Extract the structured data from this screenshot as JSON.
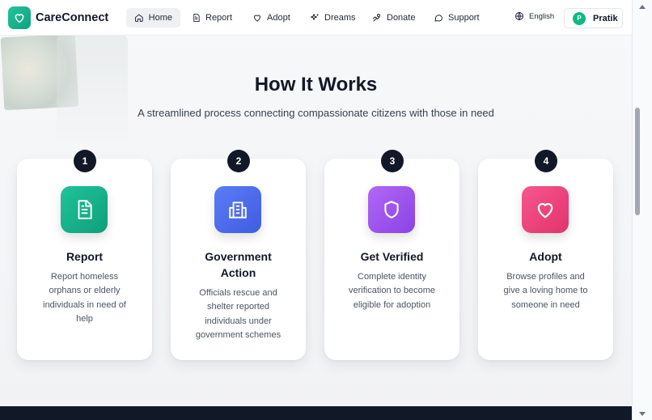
{
  "brand": {
    "name": "CareConnect"
  },
  "nav": {
    "items": [
      {
        "label": "Home",
        "icon": "home-icon",
        "active": true
      },
      {
        "label": "Report",
        "icon": "document-icon",
        "active": false
      },
      {
        "label": "Adopt",
        "icon": "heart-icon",
        "active": false
      },
      {
        "label": "Dreams",
        "icon": "sparkles-icon",
        "active": false
      },
      {
        "label": "Donate",
        "icon": "hand-coin-icon",
        "active": false
      },
      {
        "label": "Support",
        "icon": "chat-icon",
        "active": false
      }
    ],
    "language": "English",
    "user": {
      "initial": "P",
      "name": "Pratik"
    }
  },
  "hero": {
    "title": "How It Works",
    "subtitle": "A streamlined process connecting compassionate citizens with those in need"
  },
  "steps": [
    {
      "number": "1",
      "title_lines": [
        "Report"
      ],
      "desc_lines": [
        "Report homeless",
        "orphans or elderly",
        "individuals in need of",
        "help"
      ],
      "icon": "document-icon",
      "colors": [
        "#1fc49a",
        "#0f9f7a"
      ]
    },
    {
      "number": "2",
      "title_lines": [
        "Government",
        "Action"
      ],
      "desc_lines": [
        "Officials rescue and",
        "shelter reported",
        "individuals under",
        "government schemes"
      ],
      "icon": "building-icon",
      "colors": [
        "#5b7cf7",
        "#3f5de0"
      ]
    },
    {
      "number": "3",
      "title_lines": [
        "Get Verified"
      ],
      "desc_lines": [
        "Complete identity",
        "verification to become",
        "eligible for adoption"
      ],
      "icon": "shield-icon",
      "colors": [
        "#b267f5",
        "#8a43e6"
      ]
    },
    {
      "number": "4",
      "title_lines": [
        "Adopt"
      ],
      "desc_lines": [
        "Browse profiles and",
        "give a loving home to",
        "someone in need"
      ],
      "icon": "heart-icon",
      "colors": [
        "#f7568f",
        "#e2336b"
      ]
    }
  ],
  "colors": {
    "dark": "#111827",
    "accent": "#10b981",
    "footer": "#111827"
  }
}
